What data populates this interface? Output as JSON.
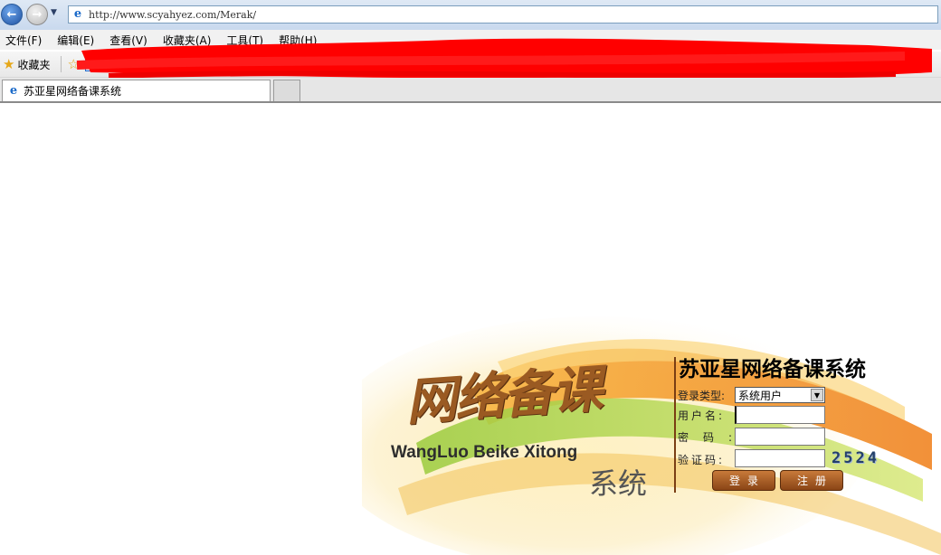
{
  "browser": {
    "url": "http://www.scyahyez.com/Merak/",
    "menu": [
      "文件(F)",
      "编辑(E)",
      "查看(V)",
      "收藏夹(A)",
      "工具(T)",
      "帮助(H)"
    ],
    "favorites_label": "收藏夹",
    "tab_title": "苏亚星网络备课系统"
  },
  "banner": {
    "brand_cn": "网络备课",
    "brand_pinyin": "WangLuo Beike Xitong",
    "brand_xitong": "系统"
  },
  "login": {
    "title": "苏亚星网络备课系统",
    "type_label": "登录类型:",
    "type_value": "系统用户",
    "username_label": "用户名:",
    "password_label": "密码:",
    "code_label": "验证码:",
    "captcha": "2524",
    "login_button": "登录",
    "register_button": "注册"
  },
  "colors": {
    "accent_brown": "#9a5a22",
    "button_brown": "#8a4516",
    "redaction_red": "#ff0000"
  }
}
